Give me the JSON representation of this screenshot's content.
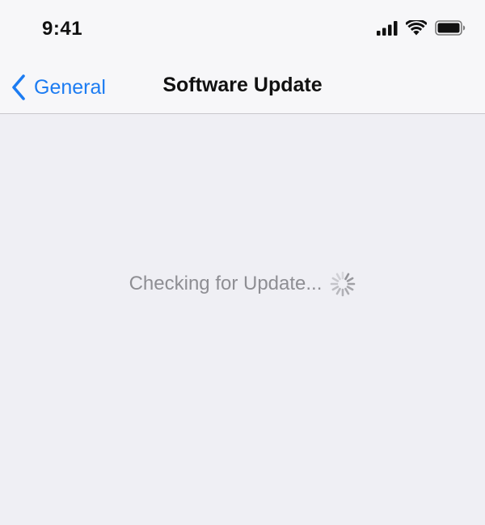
{
  "status_bar": {
    "time": "9:41",
    "icons": [
      "signal-icon",
      "wifi-icon",
      "battery-icon"
    ]
  },
  "nav": {
    "back_label": "General",
    "title": "Software Update"
  },
  "content": {
    "status_text": "Checking for Update..."
  },
  "colors": {
    "accent": "#1c7cf2",
    "background": "#efeff4",
    "bar_background": "#f7f7f9",
    "secondary_text": "#8e8e93"
  }
}
